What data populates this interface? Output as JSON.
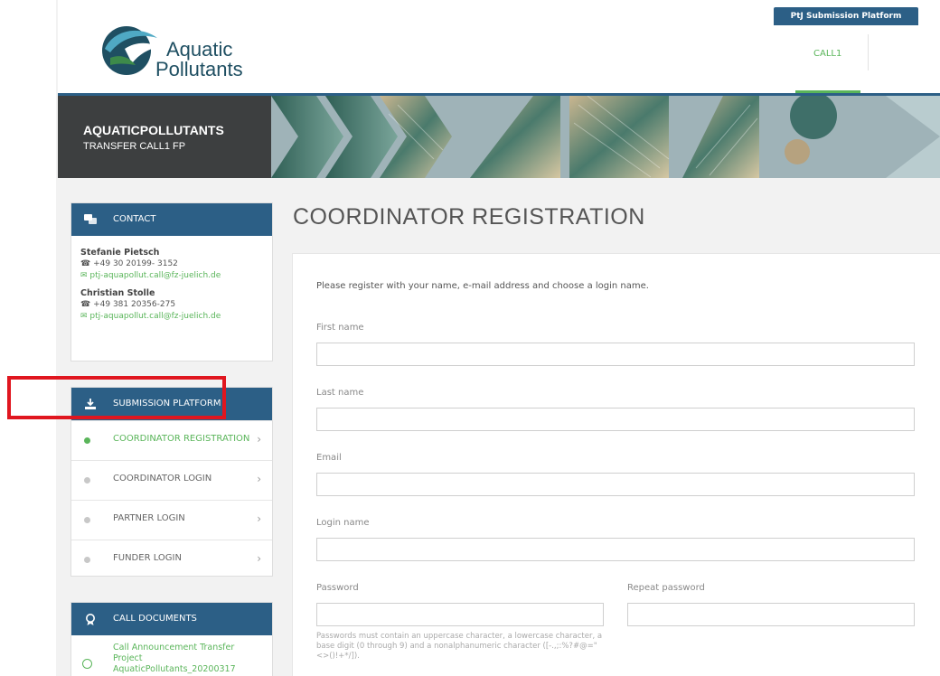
{
  "header": {
    "logo_line1": "Aquatic",
    "logo_line2": "Pollutants",
    "platform_tab": "PtJ Submission Platform",
    "nav_call": "CALL1"
  },
  "banner": {
    "title": "AQUATICPOLLUTANTS",
    "subtitle": "TRANSFER CALL1 FP"
  },
  "contact": {
    "heading": "CONTACT",
    "people": [
      {
        "name": "Stefanie Pietsch",
        "phone": "+49 30 20199- 3152",
        "email": "ptj-aquapollut.call@fz-juelich.de"
      },
      {
        "name": "Christian Stolle",
        "phone": "+49 381 20356-275",
        "email": "ptj-aquapollut.call@fz-juelich.de"
      }
    ]
  },
  "submission": {
    "heading": "SUBMISSION PLATFORM",
    "items": [
      {
        "label": "COORDINATOR REGISTRATION",
        "active": true
      },
      {
        "label": "COORDINATOR LOGIN",
        "active": false
      },
      {
        "label": "PARTNER LOGIN",
        "active": false
      },
      {
        "label": "FUNDER LOGIN",
        "active": false
      }
    ]
  },
  "documents": {
    "heading": "CALL DOCUMENTS",
    "items": [
      "Call Announcement Transfer Project AquaticPollutants_20200317"
    ]
  },
  "main": {
    "title": "COORDINATOR REGISTRATION",
    "intro": "Please register with your name, e-mail address and choose a login name.",
    "fields": {
      "first_name": {
        "label": "First name",
        "value": ""
      },
      "last_name": {
        "label": "Last name",
        "value": ""
      },
      "email": {
        "label": "Email",
        "value": ""
      },
      "login": {
        "label": "Login name",
        "value": ""
      },
      "password": {
        "label": "Password",
        "value": ""
      },
      "repeat": {
        "label": "Repeat password",
        "value": ""
      }
    },
    "password_hint": "Passwords must contain an uppercase character, a lowercase character, a base digit (0 through 9) and a nonalphanumeric character ([-.,;:%?#@=\"<>()!+*/])."
  },
  "colors": {
    "primary": "#2c5f86",
    "accent": "#5ab55a",
    "highlight": "#e0161f"
  }
}
